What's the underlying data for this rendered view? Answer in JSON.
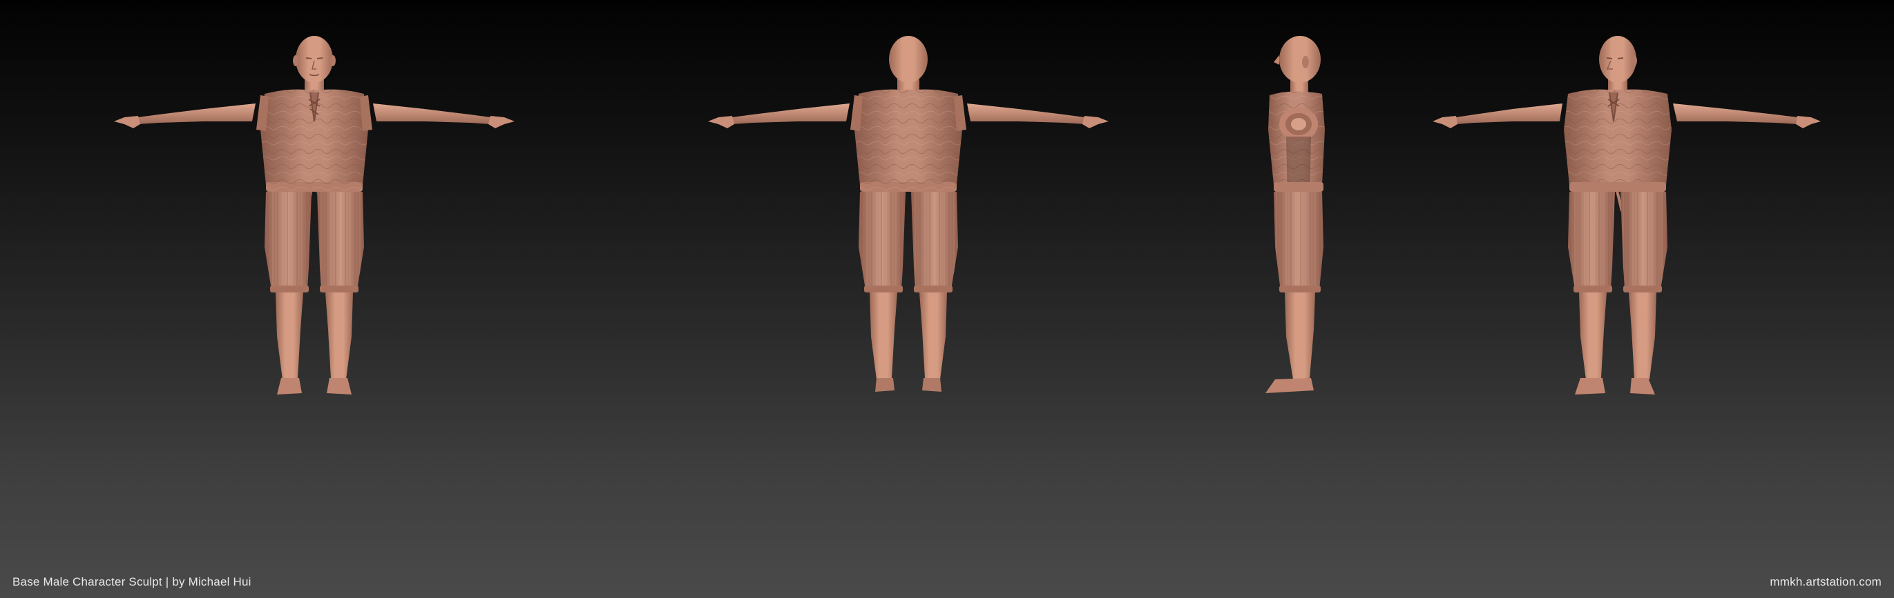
{
  "caption": {
    "title": "Base Male Character Sculpt | by Michael Hui",
    "site": "mmkh.artstation.com"
  },
  "views": [
    {
      "name": "front",
      "icon": "figure-front-icon"
    },
    {
      "name": "back",
      "icon": "figure-back-icon"
    },
    {
      "name": "side",
      "icon": "figure-side-icon"
    },
    {
      "name": "three-quarter",
      "icon": "figure-three-quarter-icon"
    }
  ],
  "colors": {
    "skin": "#c98f78",
    "skin_shadow": "#9e6a57",
    "skin_highlight": "#e2aa92",
    "cloth": "#b98370",
    "cloth_shadow": "#8c5c4c",
    "background_top": "#020202",
    "background_bottom": "#4a4a4a"
  }
}
